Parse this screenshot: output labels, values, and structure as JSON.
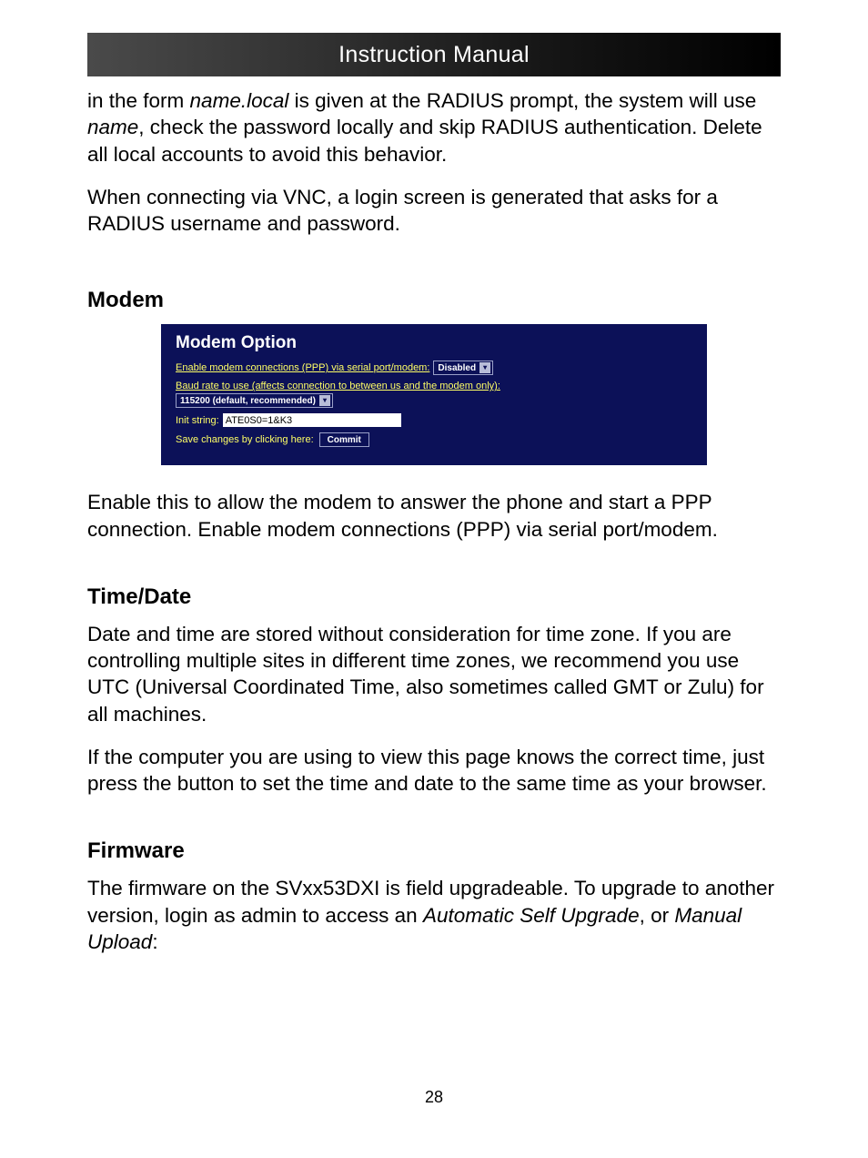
{
  "header": {
    "title": "Instruction Manual"
  },
  "intro": {
    "p1_pre": "in the form ",
    "p1_i1": "name.local",
    "p1_mid1": " is given at the RADIUS prompt, the system will use ",
    "p1_i2": "name",
    "p1_post": ", check the password locally and skip RADIUS authentication. Delete all local accounts to avoid this behavior.",
    "p2": "When connecting via VNC, a login screen is generated that asks for a RADIUS username and password."
  },
  "modem": {
    "heading": "Modem",
    "panel_title": "Modem Option",
    "enable_label": "Enable modem connections (PPP) via serial port/modem:",
    "enable_value": "Disabled",
    "baud_label": "Baud rate to use (affects connection to between us and the modem only):",
    "baud_value": "115200 (default, recommended)",
    "init_label": "Init string:",
    "init_value": "ATE0S0=1&K3",
    "save_label": "Save changes by clicking here:",
    "commit_label": "Commit",
    "description": "Enable this to allow the modem to answer the phone and start a PPP connection. Enable modem connections (PPP) via serial port/modem."
  },
  "time": {
    "heading": "Time/Date",
    "p1": "Date and time are stored without consideration for time zone. If you are controlling multiple sites in different time zones, we recommend you use UTC (Universal Coordinated Time, also sometimes called GMT or Zulu) for all machines.",
    "p2": "If the computer you are using to view this page knows the correct time, just press the button to set the time and date to the same time as your browser."
  },
  "firmware": {
    "heading": "Firmware",
    "p1_pre": "The firmware on the SVxx53DXI is field upgradeable. To upgrade to another version, login as admin to access an ",
    "p1_i1": "Automatic Self Upgrade",
    "p1_mid": ", or ",
    "p1_i2": "Manual Upload",
    "p1_post": ":"
  },
  "page_number": "28"
}
